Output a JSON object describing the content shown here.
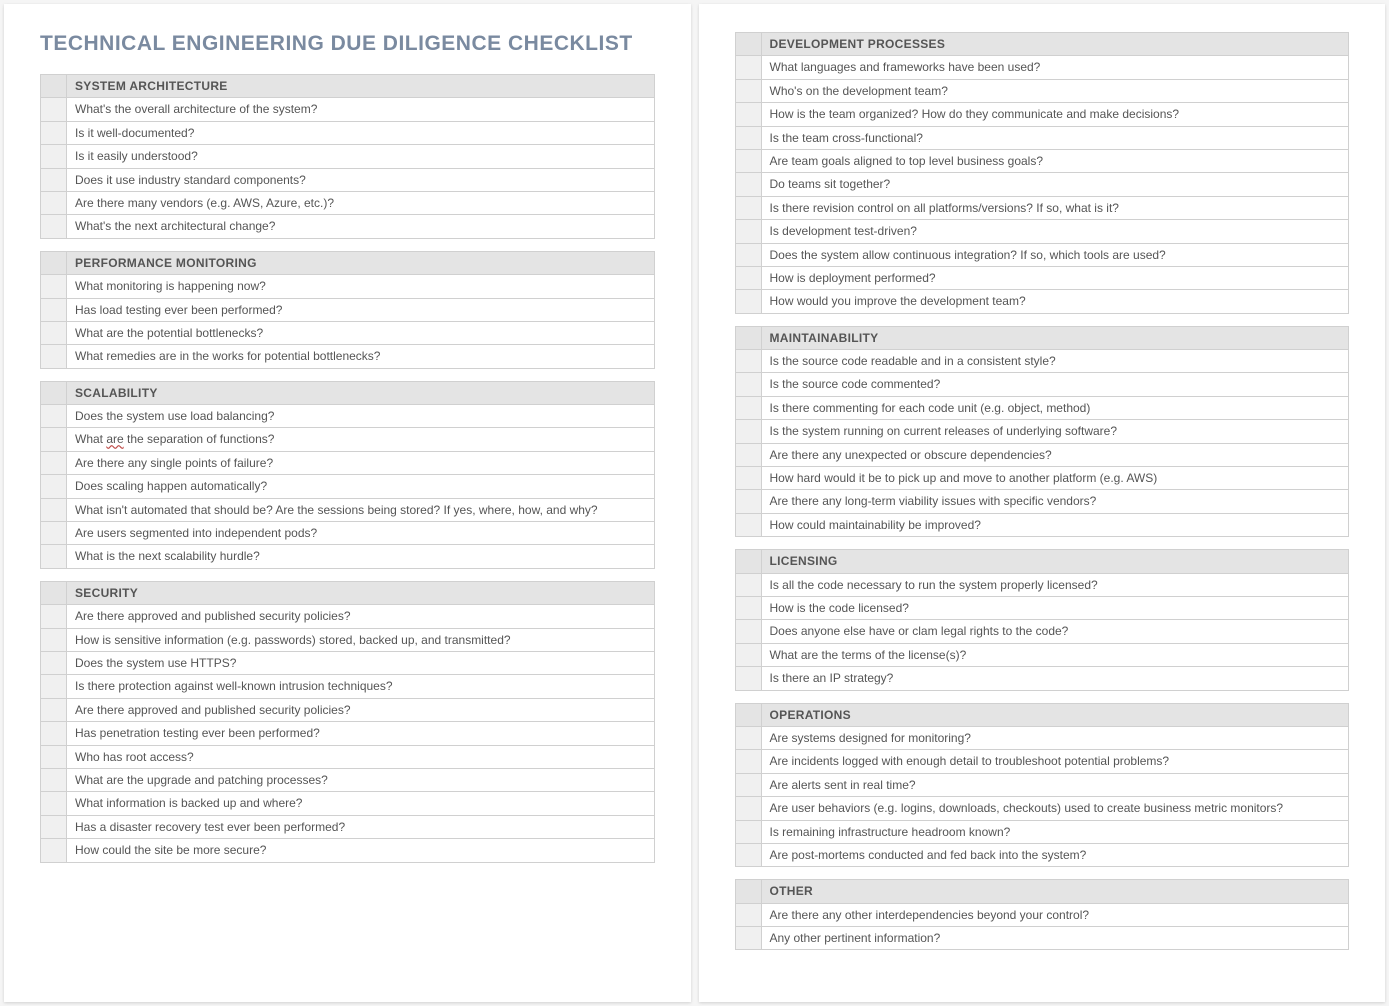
{
  "title": "TECHNICAL ENGINEERING DUE DILIGENCE CHECKLIST",
  "leftSections": [
    {
      "heading": "SYSTEM ARCHITECTURE",
      "items": [
        "What's the overall architecture of the system?",
        "Is it well-documented?",
        "Is it easily understood?",
        "Does it use industry standard components?",
        "Are there many vendors (e.g. AWS, Azure, etc.)?",
        "What's the next architectural change?"
      ]
    },
    {
      "heading": "PERFORMANCE MONITORING",
      "items": [
        "What monitoring is happening now?",
        "Has load testing ever been performed?",
        "What are the potential bottlenecks?",
        "What remedies are in the works for potential bottlenecks?"
      ]
    },
    {
      "heading": "SCALABILITY",
      "items": [
        "Does the system use load balancing?",
        "What are the separation of functions?",
        "Are there any single points of failure?",
        "Does scaling happen automatically?",
        "What isn't automated that should be? Are the sessions being stored? If yes, where, how, and why?",
        "Are users segmented into independent pods?",
        "What is the next scalability hurdle?"
      ],
      "underlineIdx": 1,
      "underlineWord": "are"
    },
    {
      "heading": "SECURITY",
      "items": [
        "Are there approved and published security policies?",
        "How is sensitive information (e.g. passwords) stored, backed up, and transmitted?",
        "Does the system use HTTPS?",
        "Is there protection against well-known intrusion techniques?",
        "Are there approved and published security policies?",
        "Has penetration testing ever been performed?",
        "Who has root access?",
        "What are the upgrade and patching processes?",
        "What information is backed up and where?",
        "Has a disaster recovery test ever been performed?",
        "How could the site be more secure?"
      ]
    }
  ],
  "rightSections": [
    {
      "heading": "DEVELOPMENT PROCESSES",
      "items": [
        "What languages and frameworks have been used?",
        "Who's on the development team?",
        "How is the team organized? How do they communicate and make decisions?",
        "Is the team cross-functional?",
        "Are team goals aligned to top level business goals?",
        "Do teams sit together?",
        "Is there revision control on all platforms/versions? If so, what is it?",
        "Is development test-driven?",
        "Does the system allow continuous integration? If so, which tools are used?",
        "How is deployment performed?",
        "How would you improve the development team?"
      ]
    },
    {
      "heading": "MAINTAINABILITY",
      "items": [
        "Is the source code readable and in a consistent style?",
        "Is the source code commented?",
        "Is there commenting for each code unit (e.g. object, method)",
        "Is the system running on current releases of underlying software?",
        "Are there any unexpected or obscure dependencies?",
        "How hard would it be to pick up and move to another platform (e.g. AWS)",
        "Are there any long-term viability issues with specific vendors?",
        "How could maintainability be improved?"
      ]
    },
    {
      "heading": "LICENSING",
      "items": [
        "Is all the code necessary to run the system properly licensed?",
        "How is the code licensed?",
        "Does anyone else have or clam legal rights to the code?",
        "What are the terms of the license(s)?",
        "Is there an IP strategy?"
      ]
    },
    {
      "heading": "OPERATIONS",
      "items": [
        "Are systems designed for monitoring?",
        "Are incidents logged with enough detail to troubleshoot potential problems?",
        "Are alerts sent in real time?",
        "Are user behaviors (e.g. logins, downloads, checkouts) used to create business metric monitors?",
        "Is remaining infrastructure headroom known?",
        "Are post-mortems conducted and fed back into the system?"
      ]
    },
    {
      "heading": "OTHER",
      "items": [
        "Are there any other interdependencies beyond your control?",
        "Any other pertinent information?"
      ]
    }
  ]
}
